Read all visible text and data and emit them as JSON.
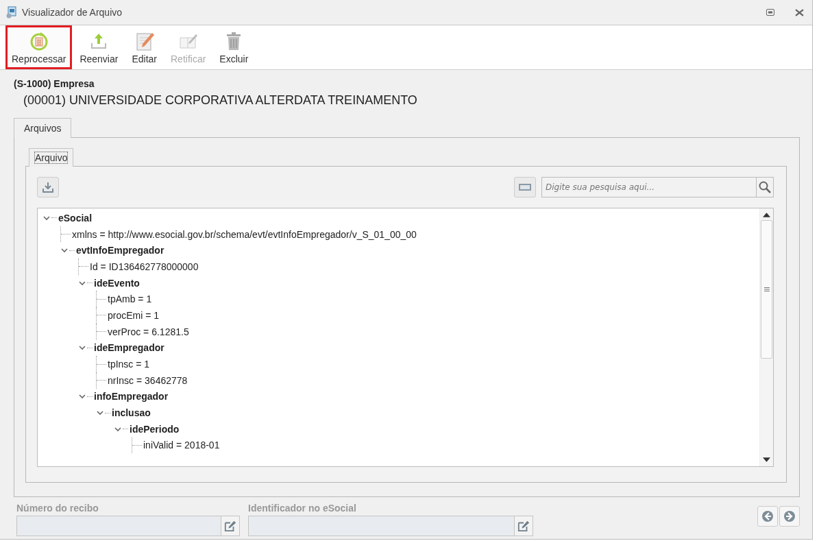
{
  "window": {
    "title": "Visualizador de Arquivo"
  },
  "toolbar": [
    {
      "label": "Reprocessar",
      "disabled": false,
      "highlighted": true
    },
    {
      "label": "Reenviar",
      "disabled": false,
      "highlighted": false
    },
    {
      "label": "Editar",
      "disabled": false,
      "highlighted": false
    },
    {
      "label": "Retificar",
      "disabled": true,
      "highlighted": false
    },
    {
      "label": "Excluir",
      "disabled": false,
      "highlighted": false
    }
  ],
  "header": {
    "event": "(S-1000) Empresa",
    "company": "(00001) UNIVERSIDADE CORPORATIVA ALTERDATA TREINAMENTO"
  },
  "outer_tabs": [
    {
      "label": "Arquivos",
      "selected": true
    }
  ],
  "inner_tabs": [
    {
      "label": "Arquivo",
      "selected": true
    }
  ],
  "search": {
    "placeholder": "Digite sua pesquisa aqui..."
  },
  "tree": [
    {
      "kind": "element",
      "label": "eSocial",
      "expanded": true,
      "children": [
        {
          "kind": "attribute",
          "label": "xmlns = http://www.esocial.gov.br/schema/evt/evtInfoEmpregador/v_S_01_00_00"
        },
        {
          "kind": "element",
          "label": "evtInfoEmpregador",
          "expanded": true,
          "children": [
            {
              "kind": "attribute",
              "label": "Id = ID136462778000000"
            },
            {
              "kind": "element",
              "label": "ideEvento",
              "expanded": true,
              "children": [
                {
                  "kind": "attribute",
                  "label": "tpAmb = 1"
                },
                {
                  "kind": "attribute",
                  "label": "procEmi = 1"
                },
                {
                  "kind": "attribute",
                  "label": "verProc = 6.1281.5"
                }
              ]
            },
            {
              "kind": "element",
              "label": "ideEmpregador",
              "expanded": true,
              "children": [
                {
                  "kind": "attribute",
                  "label": "tpInsc = 1"
                },
                {
                  "kind": "attribute",
                  "label": "nrInsc = 36462778"
                }
              ]
            },
            {
              "kind": "element",
              "label": "infoEmpregador",
              "expanded": true,
              "children": [
                {
                  "kind": "element",
                  "label": "inclusao",
                  "expanded": true,
                  "children": [
                    {
                      "kind": "element",
                      "label": "idePeriodo",
                      "expanded": true,
                      "children": [
                        {
                          "kind": "attribute",
                          "label": "iniValid = 2018-01"
                        }
                      ]
                    }
                  ]
                }
              ]
            }
          ]
        }
      ]
    }
  ],
  "fields": [
    {
      "label": "Número do recibo"
    },
    {
      "label": "Identificador no eSocial"
    }
  ]
}
